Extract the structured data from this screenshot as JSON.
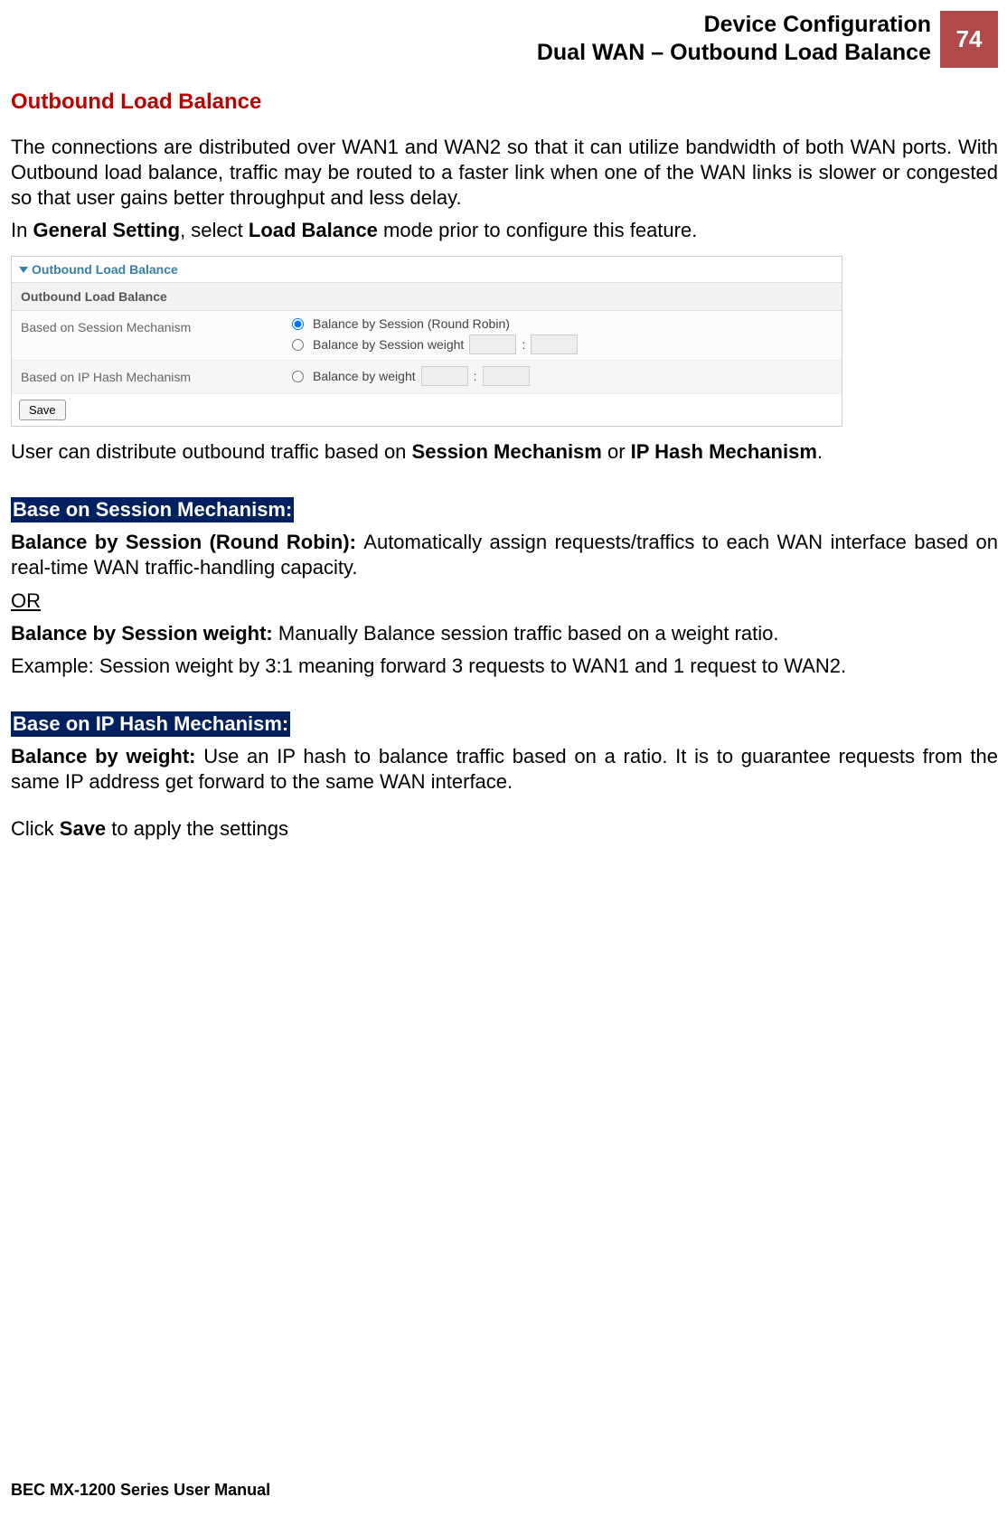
{
  "header": {
    "line1": "Device Configuration",
    "line2": "Dual WAN – Outbound Load Balance",
    "page_number": "74"
  },
  "section_title": "Outbound Load Balance",
  "intro_para": "The connections are distributed over WAN1 and WAN2 so that it can utilize bandwidth of both WAN ports. With Outbound load balance, traffic may be routed to a faster link when one of the WAN links is slower or congested so that user gains better throughput and less delay.",
  "general_setting_line": {
    "prefix": "In ",
    "bold1": "General Setting",
    "mid": ", select ",
    "bold2": "Load Balance",
    "suffix": " mode prior to configure this feature."
  },
  "ui": {
    "section_header": "Outbound Load Balance",
    "subheader": "Outbound Load Balance",
    "rows": [
      {
        "label": "Based on Session Mechanism",
        "options": [
          {
            "text": "Balance by Session (Round Robin)",
            "checked": true,
            "has_inputs": false
          },
          {
            "text": "Balance by Session weight",
            "checked": false,
            "has_inputs": true,
            "sep": ":"
          }
        ]
      },
      {
        "label": "Based on IP Hash Mechanism",
        "options": [
          {
            "text": "Balance by weight",
            "checked": false,
            "has_inputs": true,
            "sep": ":"
          }
        ]
      }
    ],
    "save_button": "Save"
  },
  "after_ui_line": {
    "prefix": "User can distribute outbound traffic based on ",
    "bold1": "Session Mechanism",
    "mid": " or ",
    "bold2": "IP Hash Mechanism",
    "suffix": "."
  },
  "session_heading": "Base on Session Mechanism:",
  "session_rr": {
    "bold": "Balance by Session (Round Robin): ",
    "text": "Automatically assign requests/traffics to each WAN interface based on real-time WAN traffic-handling capacity."
  },
  "or_text": "OR",
  "session_weight": {
    "bold": "Balance by Session weight: ",
    "text": "Manually Balance session traffic based on a weight ratio."
  },
  "session_example": "Example: Session weight by 3:1 meaning forward 3 requests to WAN1 and 1 request to WAN2.",
  "iphash_heading": "Base on IP Hash Mechanism:",
  "iphash_weight": {
    "bold": "Balance by weight: ",
    "text": "Use an IP hash to balance traffic based on a ratio. It is to guarantee requests from the same IP address get forward to the same WAN interface."
  },
  "click_save": {
    "prefix": "Click ",
    "bold": "Save",
    "suffix": " to apply the settings"
  },
  "footer": "BEC MX-1200 Series User Manual"
}
